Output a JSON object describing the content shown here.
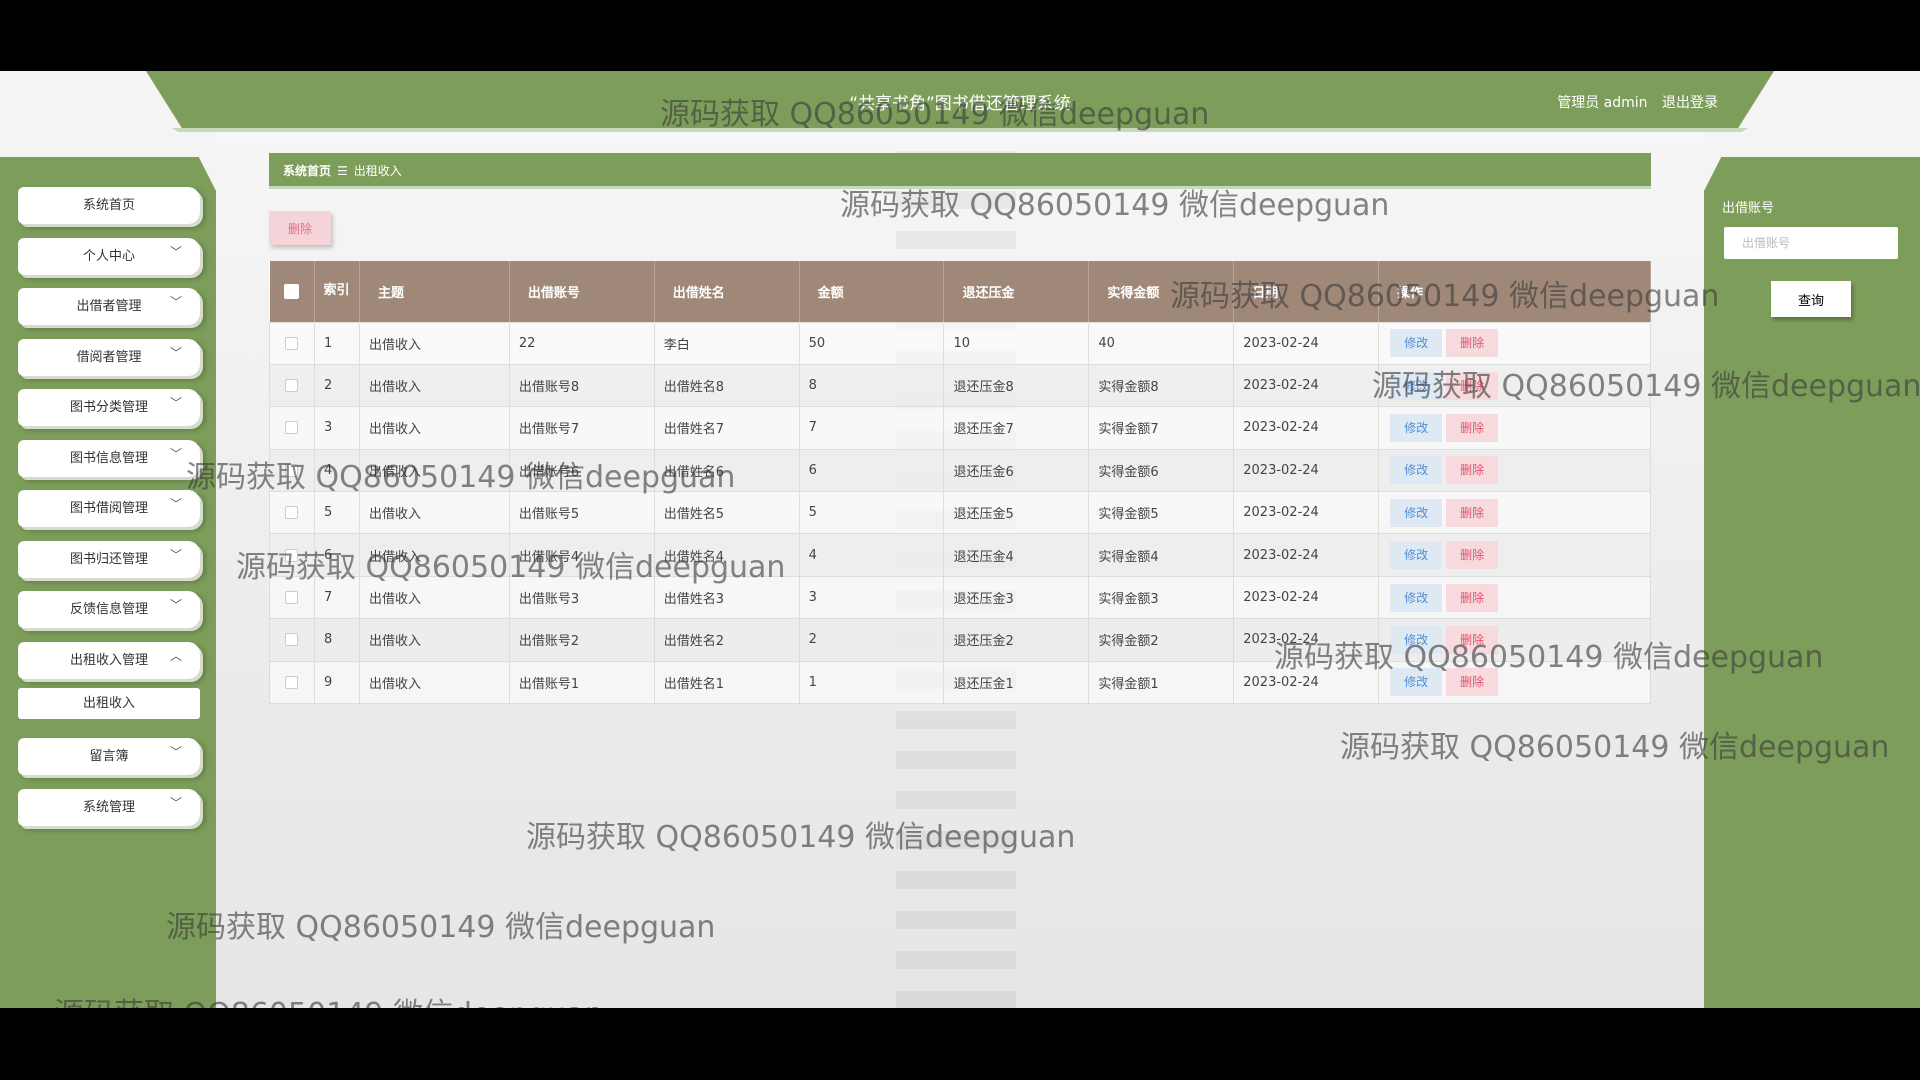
{
  "header": {
    "title": "“共享书角”图书借还管理系统",
    "user_label": "管理员 admin",
    "logout_label": "退出登录"
  },
  "sidebar": {
    "items": [
      {
        "label": "系统首页",
        "chevron": ""
      },
      {
        "label": "个人中心",
        "chevron": "﹀"
      },
      {
        "label": "出借者管理",
        "chevron": "﹀"
      },
      {
        "label": "借阅者管理",
        "chevron": "﹀"
      },
      {
        "label": "图书分类管理",
        "chevron": "﹀"
      },
      {
        "label": "图书信息管理",
        "chevron": "﹀"
      },
      {
        "label": "图书借阅管理",
        "chevron": "﹀"
      },
      {
        "label": "图书归还管理",
        "chevron": "﹀"
      },
      {
        "label": "反馈信息管理",
        "chevron": "﹀"
      },
      {
        "label": "出租收入管理",
        "chevron": "︿"
      },
      {
        "label": "留言簿",
        "chevron": "﹀"
      },
      {
        "label": "系统管理",
        "chevron": "﹀"
      }
    ],
    "submenu_label": "出租收入"
  },
  "breadcrumb": {
    "home": "系统首页",
    "separator": "☰",
    "current": "出租收入"
  },
  "toolbar": {
    "delete_label": "删除"
  },
  "search": {
    "label": "出借账号",
    "placeholder": "出借账号",
    "button_label": "查询"
  },
  "table": {
    "headers": [
      "索引",
      "主题",
      "出借账号",
      "出借姓名",
      "金额",
      "退还压金",
      "实得金额",
      "日期",
      "操作"
    ],
    "edit_label": "修改",
    "delete_label": "删除",
    "rows": [
      {
        "idx": "1",
        "topic": "出借收入",
        "account": "22",
        "name": "李白",
        "amount": "50",
        "deposit": "10",
        "actual": "40",
        "date": "2023-02-24"
      },
      {
        "idx": "2",
        "topic": "出借收入",
        "account": "出借账号8",
        "name": "出借姓名8",
        "amount": "8",
        "deposit": "退还压金8",
        "actual": "实得金额8",
        "date": "2023-02-24"
      },
      {
        "idx": "3",
        "topic": "出借收入",
        "account": "出借账号7",
        "name": "出借姓名7",
        "amount": "7",
        "deposit": "退还压金7",
        "actual": "实得金额7",
        "date": "2023-02-24"
      },
      {
        "idx": "4",
        "topic": "出借收入",
        "account": "出借账号6",
        "name": "出借姓名6",
        "amount": "6",
        "deposit": "退还压金6",
        "actual": "实得金额6",
        "date": "2023-02-24"
      },
      {
        "idx": "5",
        "topic": "出借收入",
        "account": "出借账号5",
        "name": "出借姓名5",
        "amount": "5",
        "deposit": "退还压金5",
        "actual": "实得金额5",
        "date": "2023-02-24"
      },
      {
        "idx": "6",
        "topic": "出借收入",
        "account": "出借账号4",
        "name": "出借姓名4",
        "amount": "4",
        "deposit": "退还压金4",
        "actual": "实得金额4",
        "date": "2023-02-24"
      },
      {
        "idx": "7",
        "topic": "出借收入",
        "account": "出借账号3",
        "name": "出借姓名3",
        "amount": "3",
        "deposit": "退还压金3",
        "actual": "实得金额3",
        "date": "2023-02-24"
      },
      {
        "idx": "8",
        "topic": "出借收入",
        "account": "出借账号2",
        "name": "出借姓名2",
        "amount": "2",
        "deposit": "退还压金2",
        "actual": "实得金额2",
        "date": "2023-02-24"
      },
      {
        "idx": "9",
        "topic": "出借收入",
        "account": "出借账号1",
        "name": "出借姓名1",
        "amount": "1",
        "deposit": "退还压金1",
        "actual": "实得金额1",
        "date": "2023-02-24"
      }
    ]
  },
  "watermark": {
    "text": "源码获取 QQ86050149 微信deepguan"
  },
  "colors": {
    "accent_green": "#7d9e5a",
    "table_header": "#a08878",
    "edit_blue": "#4f8fd4",
    "delete_red": "#e0546a"
  }
}
